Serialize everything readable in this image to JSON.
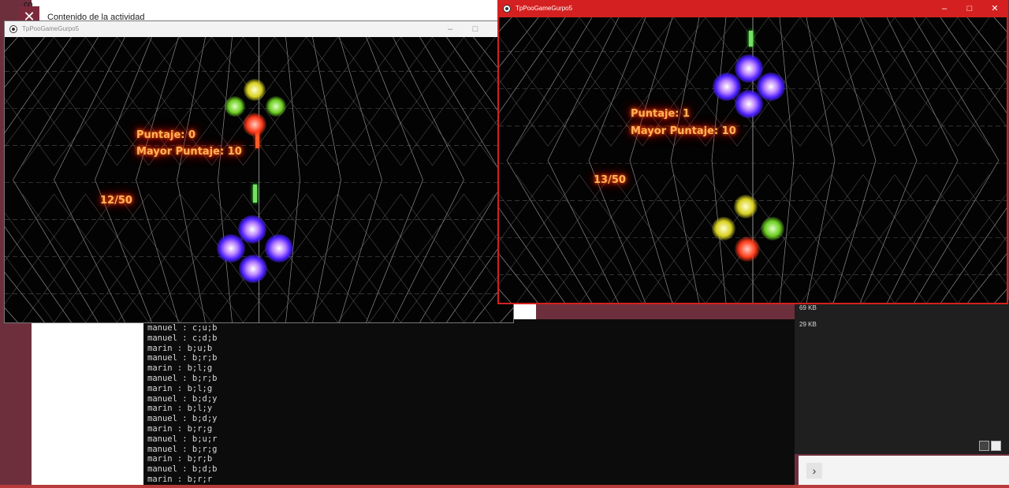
{
  "background": {
    "activity_title": "Contenido de la actividad",
    "close_symbol": "✕",
    "top_left_fragment": "co",
    "file_sizes": [
      "69 KB",
      "29 KB"
    ],
    "nav_next_symbol": "›"
  },
  "console": {
    "lines": [
      "manuel : c;u;b",
      "manuel : c;d;b",
      "marin : b;u;b",
      "manuel : b;r;b",
      "marin : b;l;g",
      "manuel : b;r;b",
      "marin : b;l;g",
      "manuel : b;d;y",
      "marin : b;l;y",
      "manuel : b;d;y",
      "marin : b;r;g",
      "manuel : b;u;r",
      "manuel : b;r;g",
      "marin : b;r;b",
      "manuel : b;d;b",
      "marin : b;r;r"
    ]
  },
  "window_a": {
    "title": "TpPooGameGurpo5",
    "controls": [
      "–",
      "□",
      "✕"
    ],
    "score_line1": "Puntaje: 0",
    "score_line2": "Mayor Puntaje: 10",
    "counter": "12/50"
  },
  "window_b": {
    "title": "TpPooGameGurpo5",
    "controls": [
      "–",
      "□",
      "✕"
    ],
    "score_line1": "Puntaje: 1",
    "score_line2": "Mayor Puntaje: 10",
    "counter": "13/50"
  },
  "colors": {
    "active_titlebar": "#d42020",
    "score_glow": "#ff5a00",
    "orb_red": "#ff3a1a",
    "orb_yellow": "#d8d020",
    "orb_green": "#6ccc20",
    "orb_blue": "#4a20ff"
  }
}
